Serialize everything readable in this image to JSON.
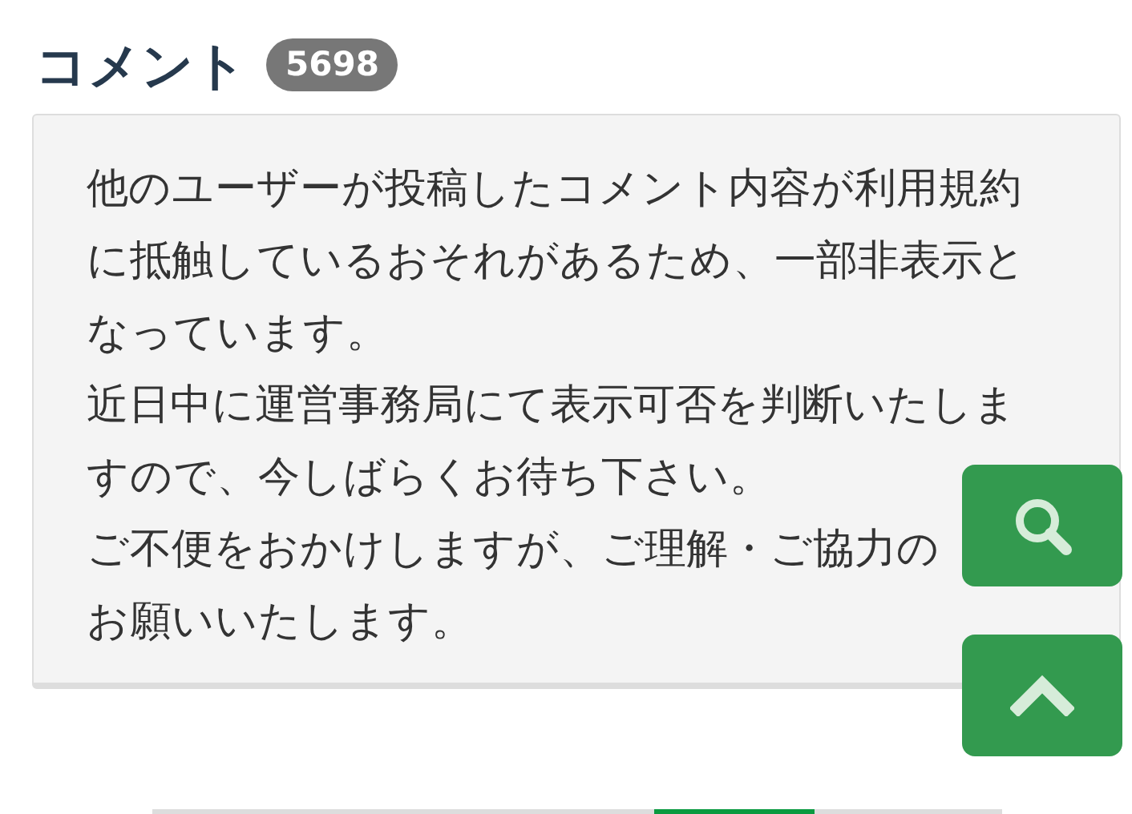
{
  "heading": {
    "title": "コメント",
    "count": "5698"
  },
  "notice": {
    "paragraphs": [
      "他のユーザーが投稿したコメント内容が利用規約に抵触しているおそれがあるため、一部非表示となっています。",
      "近日中に運営事務局にて表示可否を判断いたしますので、今しばらくお待ち下さい。",
      "ご不便をおかけしますが、ご理解・ご協力の",
      "お願いいたします。"
    ]
  }
}
